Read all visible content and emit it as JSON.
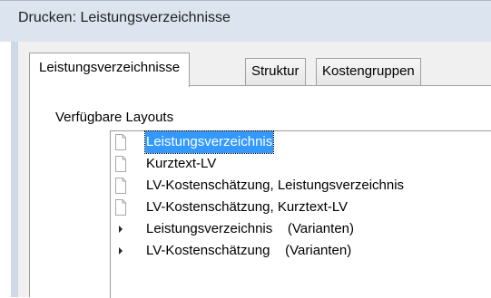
{
  "window": {
    "title": "Drucken: Leistungsverzeichnisse"
  },
  "tabs": [
    {
      "label": "Leistungsverzeichnisse",
      "active": true
    },
    {
      "label": "Struktur",
      "active": false
    },
    {
      "label": "Kostengruppen",
      "active": false
    }
  ],
  "layouts": {
    "group_label": "Verfügbare Layouts",
    "items": [
      {
        "label": "Leistungsverzeichnis",
        "icon": "document-icon",
        "selected": true
      },
      {
        "label": "Kurztext-LV",
        "icon": "document-icon",
        "selected": false
      },
      {
        "label": "LV-Kostenschätzung, Leistungsverzeichnis",
        "icon": "document-icon",
        "selected": false
      },
      {
        "label": "LV-Kostenschätzung, Kurztext-LV",
        "icon": "document-icon",
        "selected": false
      },
      {
        "label": "Leistungsverzeichnis    (Varianten)",
        "icon": "expand-arrow-icon",
        "selected": false
      },
      {
        "label": "LV-Kostenschätzung    (Varianten)",
        "icon": "expand-arrow-icon",
        "selected": false
      }
    ]
  },
  "colors": {
    "selection": "#3399ff",
    "titlebar": "#dbe4ef",
    "dialog_background": "#f0f0f0"
  }
}
